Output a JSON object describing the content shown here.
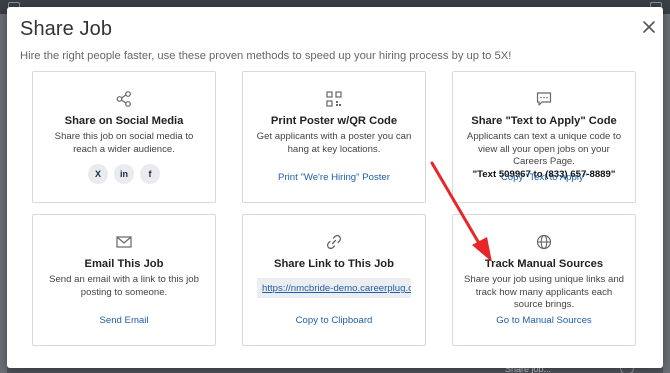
{
  "modal": {
    "title": "Share Job",
    "subtitle": "Hire the right people faster, use these proven methods to speed up your hiring process by up to 5X!"
  },
  "cards": {
    "social": {
      "title": "Share on Social Media",
      "description": "Share this job on social media to reach a wider audience.",
      "icon": "share-icon",
      "buttons": [
        "X",
        "in",
        "f"
      ]
    },
    "poster": {
      "title": "Print Poster w/QR Code",
      "description": "Get applicants with a poster you can hang at key locations.",
      "icon": "qr-code-icon",
      "link": "Print \"We're Hiring\" Poster"
    },
    "text_apply": {
      "title": "Share \"Text to Apply\" Code",
      "description": "Applicants can text a unique code to view all your open jobs on your Careers Page.",
      "code": "\"Text 509967 to (833) 657-8889\"",
      "icon": "chat-icon",
      "link": "Copy \"Text to Apply\""
    },
    "email": {
      "title": "Email This Job",
      "description": "Send an email with a link to this job posting to someone.",
      "icon": "envelope-icon",
      "link": "Send Email"
    },
    "link": {
      "title": "Share Link to This Job",
      "url": "https://nmcbride-demo.careerplug.com/jobs",
      "icon": "link-icon",
      "link": "Copy to Clipboard"
    },
    "manual": {
      "title": "Track Manual Sources",
      "description": "Share your job using unique links and track how many applicants each source brings.",
      "icon": "globe-icon",
      "link": "Go to Manual Sources"
    }
  },
  "background": {
    "bottom_text": "Share job..."
  },
  "colors": {
    "link": "#1f5fa8",
    "annotation_arrow": "#e8262a",
    "border": "#d6d9dd"
  }
}
